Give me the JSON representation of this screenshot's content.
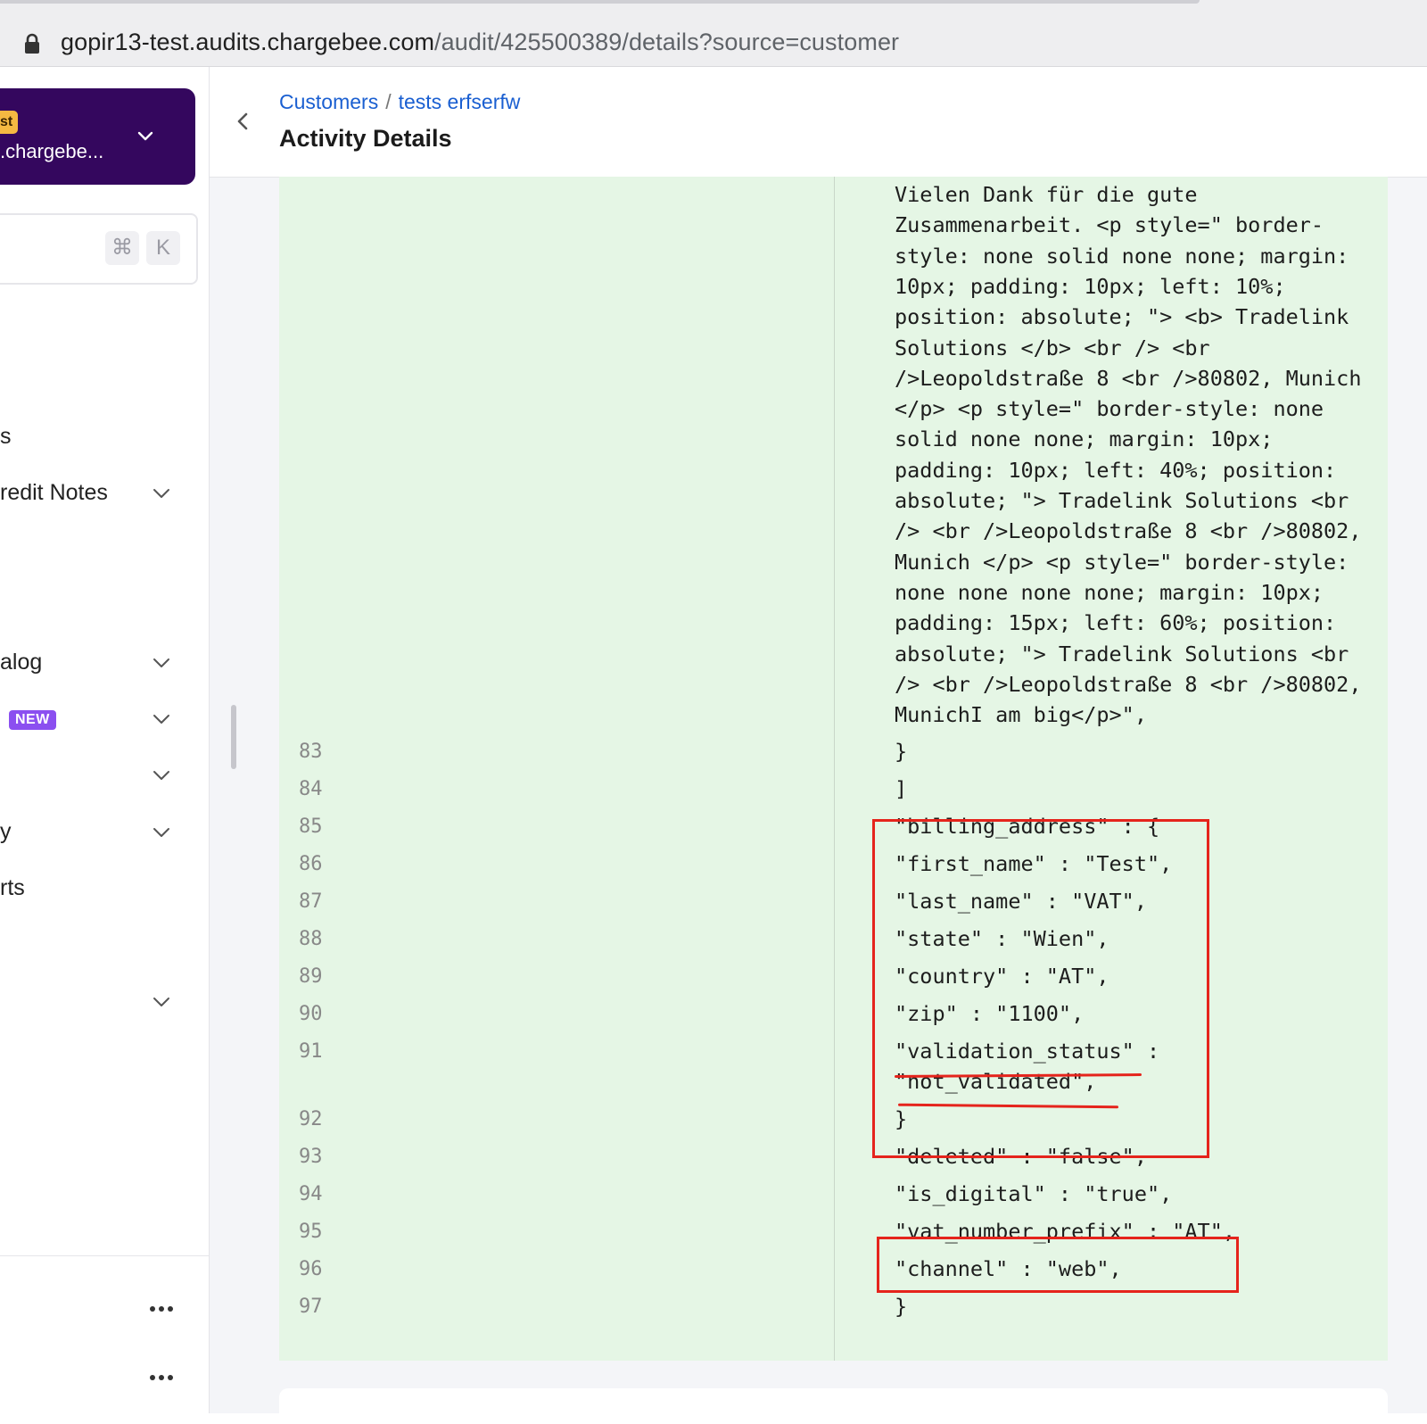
{
  "browser": {
    "url_host": "gopir13-test.audits.chargebee.com",
    "url_path": "/audit/425500389/details?source=customer"
  },
  "sidebar": {
    "site_badge": "st",
    "site_name": ".chargebe...",
    "search_shortcut": [
      "⌘",
      "K"
    ],
    "items": [
      {
        "label": "s",
        "has_chevron": false
      },
      {
        "label": "redit Notes",
        "has_chevron": true
      },
      {
        "label": "alog",
        "has_chevron": true
      },
      {
        "label": "",
        "badge": "NEW",
        "has_chevron": true
      },
      {
        "label": "",
        "has_chevron": true
      },
      {
        "label": "y",
        "has_chevron": true
      },
      {
        "label": "rts",
        "has_chevron": false
      },
      {
        "label": "",
        "has_chevron": true
      }
    ]
  },
  "header": {
    "breadcrumb": [
      "Customers",
      "tests erfserfw"
    ],
    "breadcrumb_sep": "/",
    "title": "Activity Details"
  },
  "diff": {
    "wrapped_text_lines": [
      "Vielen Dank für die gute",
      "Zusammenarbeit. <p style=\" border-",
      "style: none solid none none; margin:",
      "10px; padding: 10px; left: 10%;",
      "position: absolute; \"> <b> Tradelink",
      "Solutions </b> <br /> <br",
      "/>Leopoldstraße 8 <br />80802, Munich",
      "</p> <p style=\" border-style: none",
      "solid none none; margin: 10px;",
      "padding: 10px; left: 40%; position:",
      "absolute; \"> Tradelink Solutions <br",
      "/> <br />Leopoldstraße 8 <br />80802,",
      "Munich </p> <p style=\" border-style:",
      "none none none none; margin: 10px;",
      "padding: 15px; left: 60%; position:",
      "absolute; \"> Tradelink Solutions <br",
      "/> <br />Leopoldstraße 8 <br />80802,",
      "MunichI am big</p>\","
    ],
    "lines": [
      {
        "no": "83",
        "text": "}"
      },
      {
        "no": "84",
        "text": "]"
      },
      {
        "no": "85",
        "text": "\"billing_address\" : {"
      },
      {
        "no": "86",
        "text": "\"first_name\" : \"Test\","
      },
      {
        "no": "87",
        "text": "\"last_name\" : \"VAT\","
      },
      {
        "no": "88",
        "text": "\"state\" : \"Wien\","
      },
      {
        "no": "89",
        "text": "\"country\" : \"AT\","
      },
      {
        "no": "90",
        "text": "\"zip\" : \"1100\","
      },
      {
        "no": "91",
        "text": "\"validation_status\" :"
      },
      {
        "no": "",
        "text": "\"not_validated\","
      },
      {
        "no": "92",
        "text": "}"
      },
      {
        "no": "93",
        "text": "\"deleted\" : \"false\","
      },
      {
        "no": "94",
        "text": "\"is_digital\" : \"true\","
      },
      {
        "no": "95",
        "text": "\"vat_number_prefix\" : \"AT\","
      },
      {
        "no": "96",
        "text": "\"channel\" : \"web\","
      },
      {
        "no": "97",
        "text": "}"
      }
    ],
    "highlight_color": "#e5241c",
    "background_color": "#e5f6e5"
  }
}
